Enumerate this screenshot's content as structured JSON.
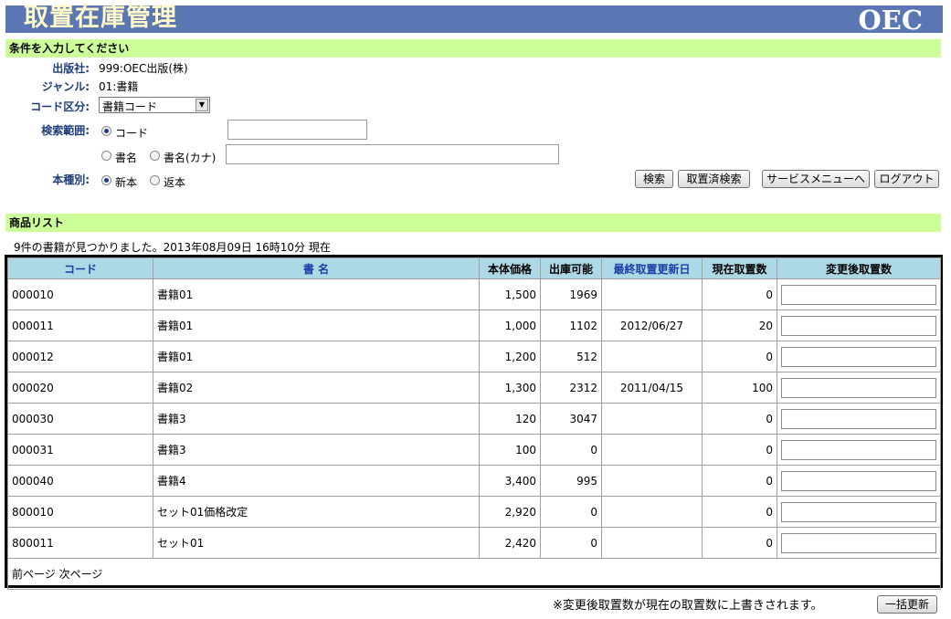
{
  "header": {
    "title": "取置在庫管理",
    "brand": "OEC"
  },
  "conditions": {
    "section_title": "条件を入力してください",
    "publisher_label": "出版社:",
    "publisher_value": "999:OEC出版(株)",
    "genre_label": "ジャンル:",
    "genre_value": "01:書籍",
    "code_type_label": "コード区分:",
    "code_type_selected": "書籍コード",
    "search_range_label": "検索範囲:",
    "range_options": {
      "code": "コード",
      "title": "書名",
      "title_kana": "書名(カナ)"
    },
    "range_selected": "code",
    "book_type_label": "本種別:",
    "book_type_options": {
      "new": "新本",
      "returned": "返本"
    },
    "book_type_selected": "new",
    "buttons": {
      "search": "検索",
      "reserved_search": "取置済検索",
      "service_menu": "サービスメニューへ",
      "logout": "ログアウト"
    }
  },
  "product_list": {
    "section_title": "商品リスト",
    "result_message": "9件の書籍が見つかりました。2013年08月09日 16時10分 現在",
    "columns": [
      "コード",
      "書 名",
      "本体価格",
      "出庫可能",
      "最終取置更新日",
      "現在取置数",
      "変更後取置数"
    ],
    "rows": [
      {
        "code": "000010",
        "title": "書籍01",
        "price": "1,500",
        "available": "1969",
        "last_updated": "",
        "current": "0",
        "new_qty": ""
      },
      {
        "code": "000011",
        "title": "書籍01",
        "price": "1,000",
        "available": "1102",
        "last_updated": "2012/06/27",
        "current": "20",
        "new_qty": ""
      },
      {
        "code": "000012",
        "title": "書籍01",
        "price": "1,200",
        "available": "512",
        "last_updated": "",
        "current": "0",
        "new_qty": ""
      },
      {
        "code": "000020",
        "title": "書籍02",
        "price": "1,300",
        "available": "2312",
        "last_updated": "2011/04/15",
        "current": "100",
        "new_qty": ""
      },
      {
        "code": "000030",
        "title": "書籍3",
        "price": "120",
        "available": "3047",
        "last_updated": "",
        "current": "0",
        "new_qty": ""
      },
      {
        "code": "000031",
        "title": "書籍3",
        "price": "100",
        "available": "0",
        "last_updated": "",
        "current": "0",
        "new_qty": ""
      },
      {
        "code": "000040",
        "title": "書籍4",
        "price": "3,400",
        "available": "995",
        "last_updated": "",
        "current": "0",
        "new_qty": ""
      },
      {
        "code": "800010",
        "title": "セット01価格改定",
        "price": "2,920",
        "available": "0",
        "last_updated": "",
        "current": "0",
        "new_qty": ""
      },
      {
        "code": "800011",
        "title": "セット01",
        "price": "2,420",
        "available": "0",
        "last_updated": "",
        "current": "0",
        "new_qty": ""
      }
    ],
    "pager": {
      "prev": "前ページ",
      "next": "次ページ"
    }
  },
  "footer": {
    "note": "※変更後取置数が現在の取置数に上書きされます。",
    "bulk_update": "一括更新"
  },
  "colors": {
    "title_bar": "#5a77b4",
    "title_text": "#fff8c8",
    "section_bar": "#ccff99",
    "table_header": "#add8e6",
    "label_text": "#1f3d7a",
    "link_header": "#1c3ea8"
  }
}
